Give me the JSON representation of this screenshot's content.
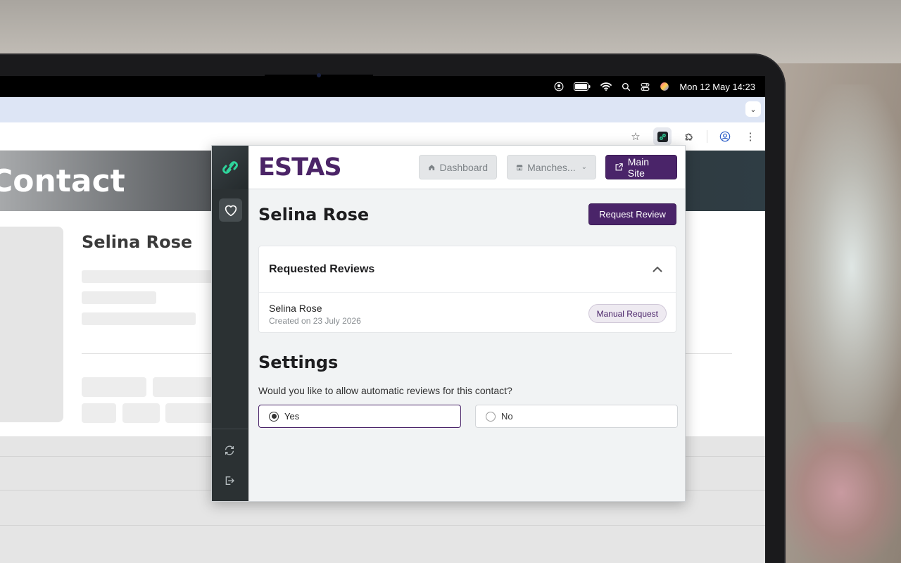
{
  "menubar": {
    "date_time": "Mon 12 May  14:23",
    "icons": [
      "user-icon",
      "battery-icon",
      "wifi-icon",
      "search-icon",
      "control-center-icon",
      "siri-icon"
    ]
  },
  "browser": {
    "tab_dropdown_icon": "chevron-down-icon",
    "toolbar_icons": [
      "star-icon",
      "estas-extension-icon",
      "puzzle-icon",
      "profile-icon",
      "kebab-menu-icon"
    ]
  },
  "page": {
    "hero_title": "Contact",
    "contact_name": "Selina Rose"
  },
  "popup": {
    "brand": "ESTAS",
    "nav": {
      "dashboard": "Dashboard",
      "location": "Manches...",
      "main_site": "Main Site"
    },
    "contact_name": "Selina Rose",
    "request_review_label": "Request Review",
    "requested_reviews": {
      "title": "Requested Reviews",
      "items": [
        {
          "name": "Selina Rose",
          "created": "Created on 23 July 2026",
          "badge": "Manual Request"
        }
      ]
    },
    "settings": {
      "title": "Settings",
      "question": "Would you like to allow automatic reviews for this contact?",
      "options": [
        {
          "label": "Yes",
          "selected": true
        },
        {
          "label": "No",
          "selected": false
        }
      ]
    },
    "sidebar_icons": [
      "link-logo-icon",
      "heart-icon",
      "refresh-icon",
      "logout-icon"
    ]
  },
  "colors": {
    "brand_purple": "#4a2469",
    "sidebar_dark": "#2b3133",
    "accent_green": "#2fd49b"
  }
}
